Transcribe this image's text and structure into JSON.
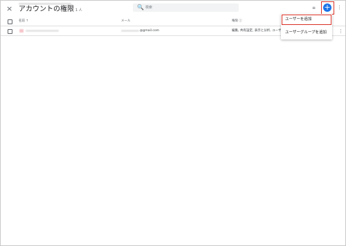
{
  "header": {
    "close_icon": "×",
    "title": "アカウントの権限",
    "count": "1 人",
    "search_icon": "🔍",
    "search_placeholder": "検索",
    "filter_icon": "≡",
    "add_icon": "+",
    "more_icon": "⋮"
  },
  "table": {
    "columns": {
      "name": "名前 ↑",
      "email": "メール",
      "role": "権限 ⓘ"
    },
    "rows": [
      {
        "email_suffix": "@gmail.com",
        "role": "編集, 共有設定, 表示と分析, ユーザー管理",
        "more_icon": "⋮"
      }
    ]
  },
  "add_menu": {
    "items": [
      "ユーザーを追加",
      "ユーザーグループを追加"
    ]
  },
  "colors": {
    "accent": "#1a73e8",
    "highlight": "#d93025"
  }
}
